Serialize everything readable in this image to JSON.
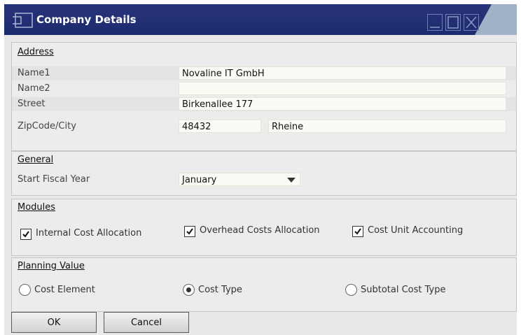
{
  "window": {
    "title": "Company Details",
    "controls": {
      "minimize": "minimize-icon",
      "maximize": "maximize-icon",
      "close": "close-icon"
    }
  },
  "address": {
    "title": "Address",
    "name1_label": "Name1",
    "name1_value": "Novaline IT GmbH",
    "name2_label": "Name2",
    "name2_value": "",
    "street_label": "Street",
    "street_value": "Birkenallee 177",
    "zipcity_label": "ZipCode/City",
    "zip_value": "48432",
    "city_value": "Rheine"
  },
  "general": {
    "title": "General",
    "fiscal_label": "Start Fiscal Year",
    "fiscal_value": "January"
  },
  "modules": {
    "title": "Modules",
    "items": [
      {
        "label": "Internal Cost Allocation",
        "checked": true
      },
      {
        "label": "Overhead Costs Allocation",
        "checked": true
      },
      {
        "label": "Cost Unit Accounting",
        "checked": true
      }
    ]
  },
  "planning": {
    "title": "Planning Value",
    "options": [
      {
        "label": "Cost Element",
        "selected": false
      },
      {
        "label": "Cost Type",
        "selected": true
      },
      {
        "label": "Subtotal Cost Type",
        "selected": false
      }
    ]
  },
  "buttons": {
    "ok": "OK",
    "cancel": "Cancel"
  }
}
